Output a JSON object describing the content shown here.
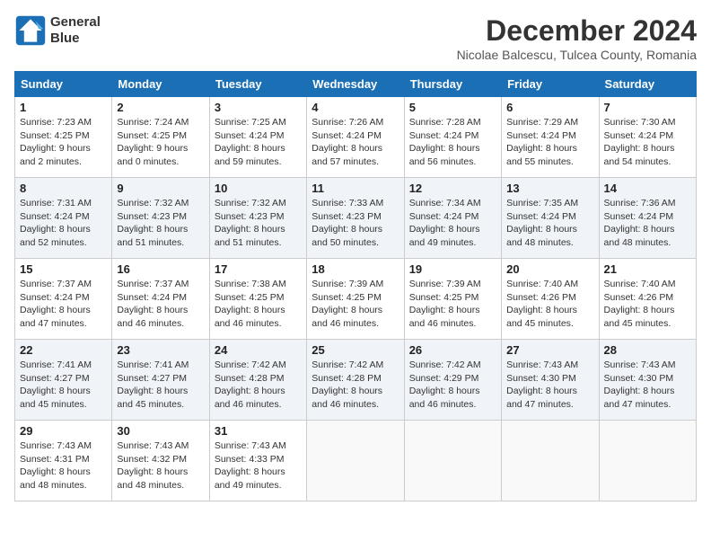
{
  "header": {
    "logo_line1": "General",
    "logo_line2": "Blue",
    "month": "December 2024",
    "location": "Nicolae Balcescu, Tulcea County, Romania"
  },
  "weekdays": [
    "Sunday",
    "Monday",
    "Tuesday",
    "Wednesday",
    "Thursday",
    "Friday",
    "Saturday"
  ],
  "weeks": [
    [
      {
        "day": "1",
        "sunrise": "Sunrise: 7:23 AM",
        "sunset": "Sunset: 4:25 PM",
        "daylight": "Daylight: 9 hours and 2 minutes."
      },
      {
        "day": "2",
        "sunrise": "Sunrise: 7:24 AM",
        "sunset": "Sunset: 4:25 PM",
        "daylight": "Daylight: 9 hours and 0 minutes."
      },
      {
        "day": "3",
        "sunrise": "Sunrise: 7:25 AM",
        "sunset": "Sunset: 4:24 PM",
        "daylight": "Daylight: 8 hours and 59 minutes."
      },
      {
        "day": "4",
        "sunrise": "Sunrise: 7:26 AM",
        "sunset": "Sunset: 4:24 PM",
        "daylight": "Daylight: 8 hours and 57 minutes."
      },
      {
        "day": "5",
        "sunrise": "Sunrise: 7:28 AM",
        "sunset": "Sunset: 4:24 PM",
        "daylight": "Daylight: 8 hours and 56 minutes."
      },
      {
        "day": "6",
        "sunrise": "Sunrise: 7:29 AM",
        "sunset": "Sunset: 4:24 PM",
        "daylight": "Daylight: 8 hours and 55 minutes."
      },
      {
        "day": "7",
        "sunrise": "Sunrise: 7:30 AM",
        "sunset": "Sunset: 4:24 PM",
        "daylight": "Daylight: 8 hours and 54 minutes."
      }
    ],
    [
      {
        "day": "8",
        "sunrise": "Sunrise: 7:31 AM",
        "sunset": "Sunset: 4:24 PM",
        "daylight": "Daylight: 8 hours and 52 minutes."
      },
      {
        "day": "9",
        "sunrise": "Sunrise: 7:32 AM",
        "sunset": "Sunset: 4:23 PM",
        "daylight": "Daylight: 8 hours and 51 minutes."
      },
      {
        "day": "10",
        "sunrise": "Sunrise: 7:32 AM",
        "sunset": "Sunset: 4:23 PM",
        "daylight": "Daylight: 8 hours and 51 minutes."
      },
      {
        "day": "11",
        "sunrise": "Sunrise: 7:33 AM",
        "sunset": "Sunset: 4:23 PM",
        "daylight": "Daylight: 8 hours and 50 minutes."
      },
      {
        "day": "12",
        "sunrise": "Sunrise: 7:34 AM",
        "sunset": "Sunset: 4:24 PM",
        "daylight": "Daylight: 8 hours and 49 minutes."
      },
      {
        "day": "13",
        "sunrise": "Sunrise: 7:35 AM",
        "sunset": "Sunset: 4:24 PM",
        "daylight": "Daylight: 8 hours and 48 minutes."
      },
      {
        "day": "14",
        "sunrise": "Sunrise: 7:36 AM",
        "sunset": "Sunset: 4:24 PM",
        "daylight": "Daylight: 8 hours and 48 minutes."
      }
    ],
    [
      {
        "day": "15",
        "sunrise": "Sunrise: 7:37 AM",
        "sunset": "Sunset: 4:24 PM",
        "daylight": "Daylight: 8 hours and 47 minutes."
      },
      {
        "day": "16",
        "sunrise": "Sunrise: 7:37 AM",
        "sunset": "Sunset: 4:24 PM",
        "daylight": "Daylight: 8 hours and 46 minutes."
      },
      {
        "day": "17",
        "sunrise": "Sunrise: 7:38 AM",
        "sunset": "Sunset: 4:25 PM",
        "daylight": "Daylight: 8 hours and 46 minutes."
      },
      {
        "day": "18",
        "sunrise": "Sunrise: 7:39 AM",
        "sunset": "Sunset: 4:25 PM",
        "daylight": "Daylight: 8 hours and 46 minutes."
      },
      {
        "day": "19",
        "sunrise": "Sunrise: 7:39 AM",
        "sunset": "Sunset: 4:25 PM",
        "daylight": "Daylight: 8 hours and 46 minutes."
      },
      {
        "day": "20",
        "sunrise": "Sunrise: 7:40 AM",
        "sunset": "Sunset: 4:26 PM",
        "daylight": "Daylight: 8 hours and 45 minutes."
      },
      {
        "day": "21",
        "sunrise": "Sunrise: 7:40 AM",
        "sunset": "Sunset: 4:26 PM",
        "daylight": "Daylight: 8 hours and 45 minutes."
      }
    ],
    [
      {
        "day": "22",
        "sunrise": "Sunrise: 7:41 AM",
        "sunset": "Sunset: 4:27 PM",
        "daylight": "Daylight: 8 hours and 45 minutes."
      },
      {
        "day": "23",
        "sunrise": "Sunrise: 7:41 AM",
        "sunset": "Sunset: 4:27 PM",
        "daylight": "Daylight: 8 hours and 45 minutes."
      },
      {
        "day": "24",
        "sunrise": "Sunrise: 7:42 AM",
        "sunset": "Sunset: 4:28 PM",
        "daylight": "Daylight: 8 hours and 46 minutes."
      },
      {
        "day": "25",
        "sunrise": "Sunrise: 7:42 AM",
        "sunset": "Sunset: 4:28 PM",
        "daylight": "Daylight: 8 hours and 46 minutes."
      },
      {
        "day": "26",
        "sunrise": "Sunrise: 7:42 AM",
        "sunset": "Sunset: 4:29 PM",
        "daylight": "Daylight: 8 hours and 46 minutes."
      },
      {
        "day": "27",
        "sunrise": "Sunrise: 7:43 AM",
        "sunset": "Sunset: 4:30 PM",
        "daylight": "Daylight: 8 hours and 47 minutes."
      },
      {
        "day": "28",
        "sunrise": "Sunrise: 7:43 AM",
        "sunset": "Sunset: 4:30 PM",
        "daylight": "Daylight: 8 hours and 47 minutes."
      }
    ],
    [
      {
        "day": "29",
        "sunrise": "Sunrise: 7:43 AM",
        "sunset": "Sunset: 4:31 PM",
        "daylight": "Daylight: 8 hours and 48 minutes."
      },
      {
        "day": "30",
        "sunrise": "Sunrise: 7:43 AM",
        "sunset": "Sunset: 4:32 PM",
        "daylight": "Daylight: 8 hours and 48 minutes."
      },
      {
        "day": "31",
        "sunrise": "Sunrise: 7:43 AM",
        "sunset": "Sunset: 4:33 PM",
        "daylight": "Daylight: 8 hours and 49 minutes."
      },
      null,
      null,
      null,
      null
    ]
  ]
}
